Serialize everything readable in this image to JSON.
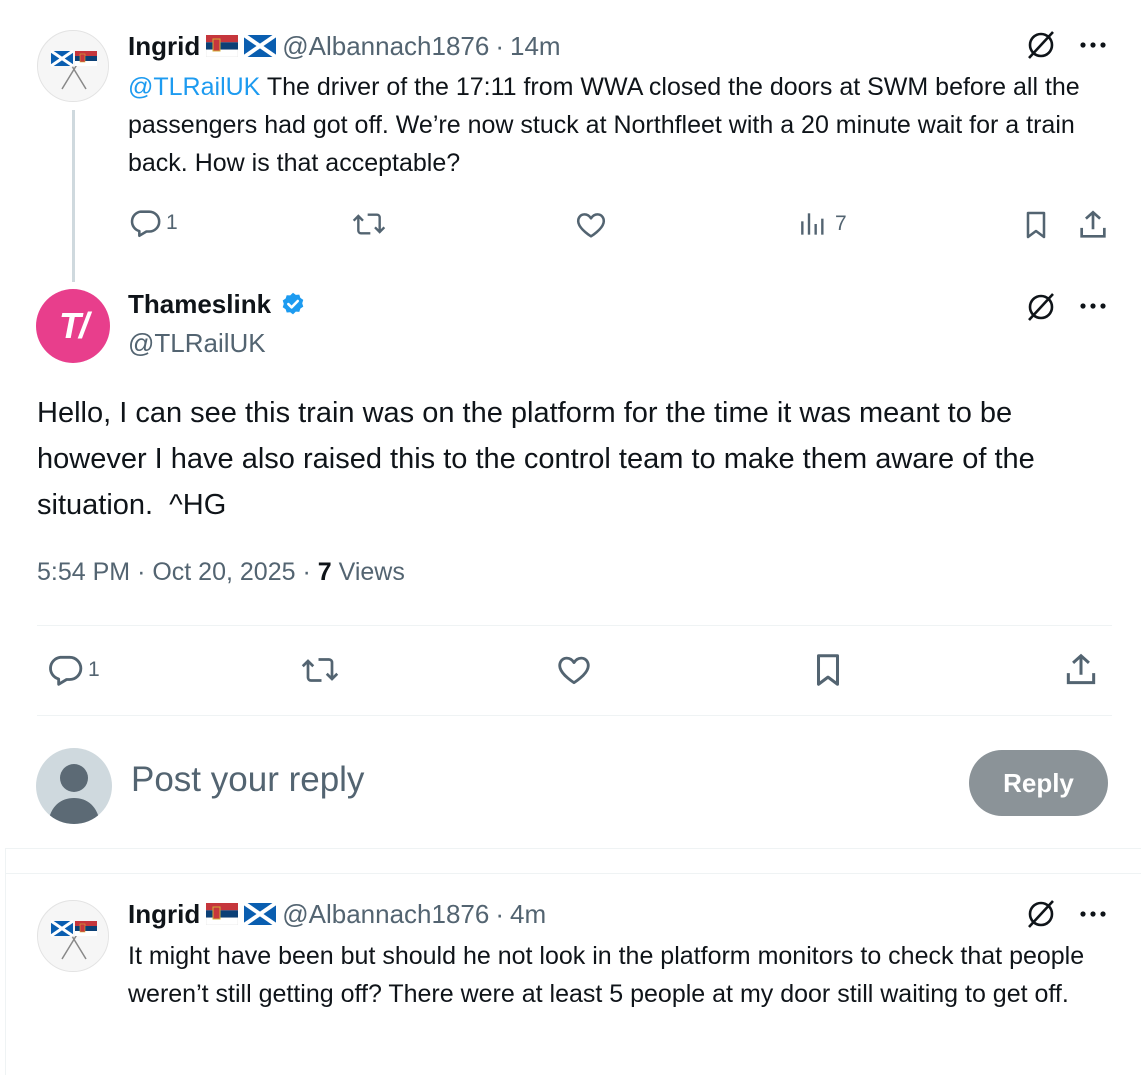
{
  "tweet1": {
    "name": "Ingrid",
    "handle": "@Albannach1876",
    "time": "14m",
    "mention": "@TLRailUK",
    "text": " The driver of the 17:11 from WWA closed the doors at SWM before all the passengers had got off. We’re now stuck at Northfleet with a 20 minute wait for a train back. How is that acceptable?",
    "reply_count": "1",
    "views_count": "7"
  },
  "main": {
    "name": "Thameslink",
    "handle": "@TLRailUK",
    "avatar_text": "T/",
    "text": "Hello, I can see this train was on the platform for the time it was meant to be however I have also raised this to the control team to make them aware of the situation.  ^HG",
    "time": "5:54 PM",
    "date": "Oct 20, 2025",
    "views_number": "7",
    "views_label": "Views",
    "reply_count": "1"
  },
  "reply_box": {
    "placeholder": "Post your reply",
    "button": "Reply"
  },
  "tweet2": {
    "name": "Ingrid",
    "handle": "@Albannach1876",
    "time": "4m",
    "text": "It might have been but should he not look in the platform monitors to check that people weren’t still getting off? There were at least 5 people at my door still waiting to get off."
  },
  "separator": "·",
  "colors": {
    "accent": "#1d9bf0",
    "thameslink_pink": "#e83e8c",
    "muted": "#536471",
    "reply_button": "#8b9398"
  },
  "icons": {
    "grok": "grok-icon",
    "more": "more-icon",
    "reply": "reply-icon",
    "retweet": "retweet-icon",
    "like": "like-icon",
    "views": "views-icon",
    "bookmark": "bookmark-icon",
    "share": "share-icon",
    "verified": "verified-icon"
  }
}
